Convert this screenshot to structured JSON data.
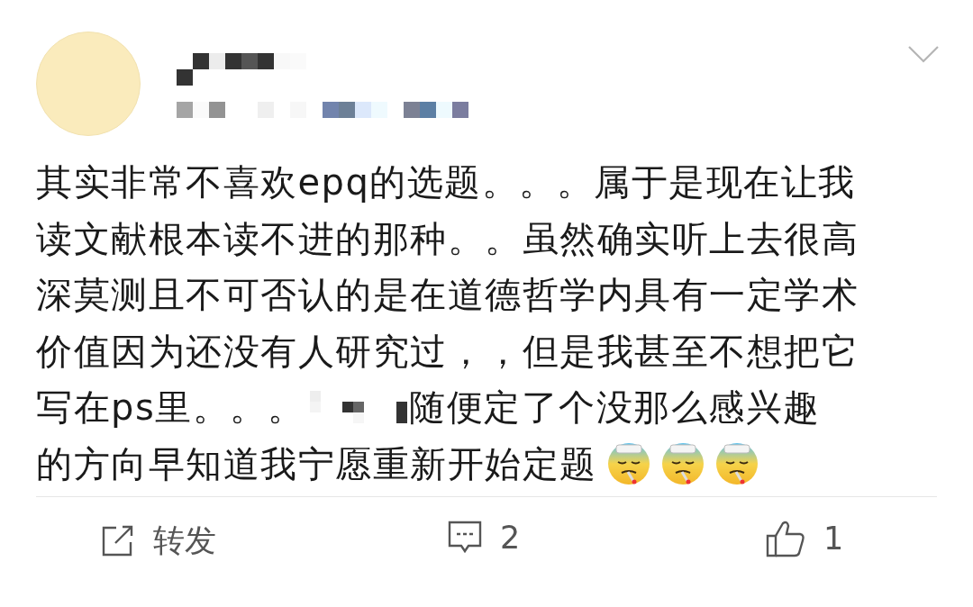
{
  "post": {
    "lines": [
      {
        "kind": "plain",
        "text": "其实非常不喜欢epq的选题。。。属于是现在让我"
      },
      {
        "kind": "plain",
        "text": "读文献根本读不进的那种。。虽然确实听上去很高"
      },
      {
        "kind": "plain",
        "text": "深莫测且不可否认的是在道德哲学内具有一定学术"
      },
      {
        "kind": "plain",
        "text": "价值因为还没有人研究过，，但是我甚至不想把它"
      },
      {
        "kind": "with-mosaic",
        "text": "写在ps里。。。",
        "text_after": "随便定了个没那么感兴趣"
      },
      {
        "kind": "plain",
        "text": "的方向早知道我宁愿重新开始定题"
      }
    ],
    "emojis": [
      {
        "kind": "sick-face"
      },
      {
        "kind": "sick-face"
      },
      {
        "kind": "sick-face"
      }
    ]
  },
  "actions": [
    {
      "kind": "repost",
      "label": "转发"
    },
    {
      "kind": "comment",
      "label": "2"
    },
    {
      "kind": "like",
      "label": "1"
    }
  ]
}
